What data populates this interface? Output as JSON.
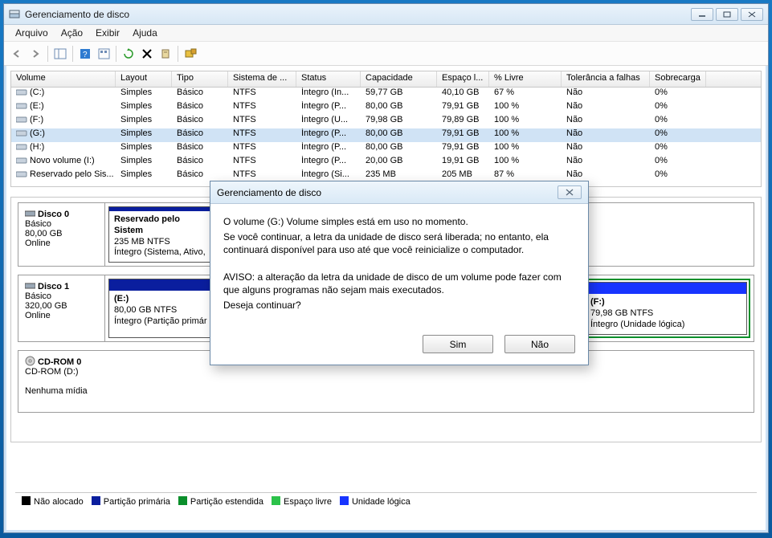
{
  "window": {
    "title": "Gerenciamento de disco"
  },
  "menu": {
    "arquivo": "Arquivo",
    "acao": "Ação",
    "exibir": "Exibir",
    "ajuda": "Ajuda"
  },
  "columns": {
    "volume": "Volume",
    "layout": "Layout",
    "tipo": "Tipo",
    "fs": "Sistema de ...",
    "status": "Status",
    "cap": "Capacidade",
    "espaco": "Espaço l...",
    "pct": "% Livre",
    "tol": "Tolerância a falhas",
    "sob": "Sobrecarga"
  },
  "rows": [
    {
      "vol": "(C:)",
      "lay": "Simples",
      "tipo": "Básico",
      "fs": "NTFS",
      "stat": "Íntegro (In...",
      "cap": "59,77 GB",
      "esp": "40,10 GB",
      "pct": "67 %",
      "tol": "Não",
      "sob": "0%",
      "sel": false
    },
    {
      "vol": "(E:)",
      "lay": "Simples",
      "tipo": "Básico",
      "fs": "NTFS",
      "stat": "Íntegro (P...",
      "cap": "80,00 GB",
      "esp": "79,91 GB",
      "pct": "100 %",
      "tol": "Não",
      "sob": "0%",
      "sel": false
    },
    {
      "vol": "(F:)",
      "lay": "Simples",
      "tipo": "Básico",
      "fs": "NTFS",
      "stat": "Íntegro (U...",
      "cap": "79,98 GB",
      "esp": "79,89 GB",
      "pct": "100 %",
      "tol": "Não",
      "sob": "0%",
      "sel": false
    },
    {
      "vol": "(G:)",
      "lay": "Simples",
      "tipo": "Básico",
      "fs": "NTFS",
      "stat": "Íntegro (P...",
      "cap": "80,00 GB",
      "esp": "79,91 GB",
      "pct": "100 %",
      "tol": "Não",
      "sob": "0%",
      "sel": true
    },
    {
      "vol": "(H:)",
      "lay": "Simples",
      "tipo": "Básico",
      "fs": "NTFS",
      "stat": "Íntegro (P...",
      "cap": "80,00 GB",
      "esp": "79,91 GB",
      "pct": "100 %",
      "tol": "Não",
      "sob": "0%",
      "sel": false
    },
    {
      "vol": "Novo volume (I:)",
      "lay": "Simples",
      "tipo": "Básico",
      "fs": "NTFS",
      "stat": "Íntegro (P...",
      "cap": "20,00 GB",
      "esp": "19,91 GB",
      "pct": "100 %",
      "tol": "Não",
      "sob": "0%",
      "sel": false
    },
    {
      "vol": "Reservado pelo Sis...",
      "lay": "Simples",
      "tipo": "Básico",
      "fs": "NTFS",
      "stat": "Íntegro (Si...",
      "cap": "235 MB",
      "esp": "205 MB",
      "pct": "87 %",
      "tol": "Não",
      "sob": "0%",
      "sel": false
    }
  ],
  "disks": {
    "d0": {
      "name": "Disco 0",
      "type": "Básico",
      "size": "80,00 GB",
      "state": "Online",
      "p1": {
        "title": "Reservado pelo Sistem",
        "detail": "235 MB NTFS",
        "status": "Íntegro (Sistema, Ativo,"
      }
    },
    "d1": {
      "name": "Disco 1",
      "type": "Básico",
      "size": "320,00 GB",
      "state": "Online",
      "pE": {
        "title": "(E:)",
        "detail": "80,00 GB NTFS",
        "status": "Íntegro (Partição primár"
      },
      "pF": {
        "title": "(F:)",
        "detail": "79,98 GB NTFS",
        "status": "Íntegro (Unidade lógica)"
      }
    },
    "cd": {
      "name": "CD-ROM 0",
      "sub": "CD-ROM (D:)",
      "empty": "Nenhuma mídia"
    }
  },
  "legend": {
    "nao": "Não alocado",
    "prim": "Partição primária",
    "ext": "Partição estendida",
    "livre": "Espaço livre",
    "log": "Unidade lógica"
  },
  "dialog": {
    "title": "Gerenciamento de disco",
    "line1": "O volume  (G:) Volume simples está em uso no momento.",
    "line2": "  Se você continuar, a letra da unidade de disco será liberada; no entanto, ela continuará disponível para uso até que você reinicialize o computador.",
    "line3": "AVISO: a alteração da letra da unidade de disco de um volume pode fazer com que alguns programas não sejam mais executados.",
    "line4": "Deseja continuar?",
    "yes": "Sim",
    "no": "Não"
  }
}
